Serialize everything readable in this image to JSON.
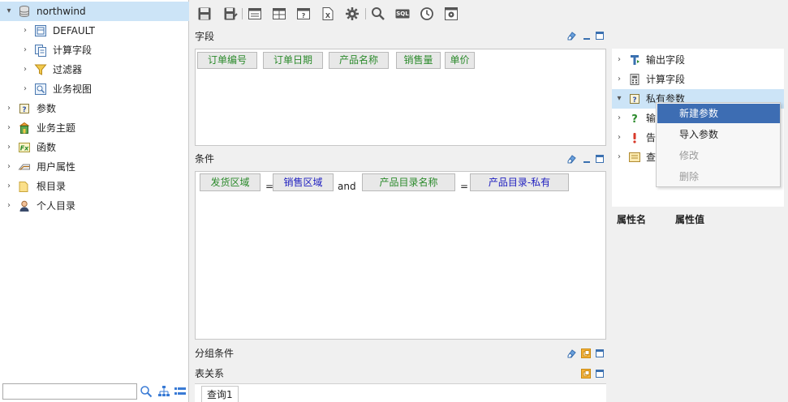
{
  "tree": {
    "root": "northwind",
    "children": [
      "DEFAULT",
      "计算字段",
      "过滤器",
      "业务视图"
    ],
    "items": [
      "参数",
      "业务主题",
      "函数",
      "用户属性",
      "根目录",
      "个人目录"
    ]
  },
  "toolbar": {
    "icons": [
      "save-icon",
      "save-as-icon",
      "layout-icon",
      "table-icon",
      "param-icon",
      "export-icon",
      "settings-icon",
      "search-icon",
      "sql-icon",
      "clock-icon",
      "query-settings-icon"
    ],
    "sql_label": "SQL"
  },
  "fields_panel": {
    "title": "字段",
    "chips": [
      "订单编号",
      "订单日期",
      "产品名称",
      "销售量",
      "单价"
    ]
  },
  "condition_panel": {
    "title": "条件",
    "row": {
      "a": "发货区域",
      "eq1": "=",
      "b": "销售区域",
      "and": "and",
      "c": "产品目录名称",
      "eq2": "=",
      "d": "产品目录-私有"
    }
  },
  "group_panel": {
    "title": "分组条件"
  },
  "relation_panel": {
    "title": "表关系"
  },
  "tabs": {
    "query1": "查询1"
  },
  "right_tree": {
    "items": [
      "输出字段",
      "计算字段",
      "私有参数",
      "输",
      "告",
      "查"
    ]
  },
  "properties": {
    "name_col": "属性名",
    "value_col": "属性值"
  },
  "context_menu": {
    "items": [
      "新建参数",
      "导入参数",
      "修改",
      "删除"
    ]
  },
  "colors": {
    "selection": "#cce4f7",
    "menu_active": "#3d6db3",
    "chip_green": "#2b8a2b",
    "chip_blue": "#2020c0"
  }
}
